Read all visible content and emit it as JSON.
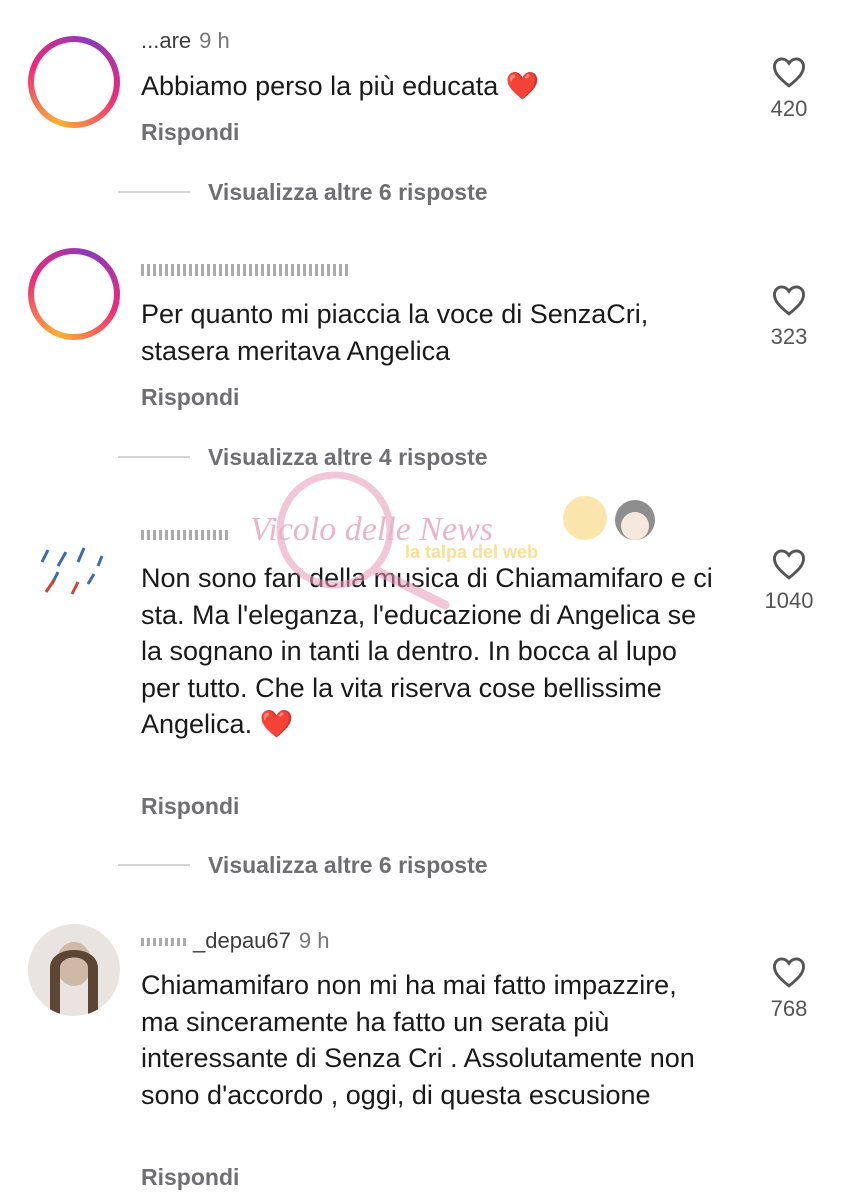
{
  "comments": [
    {
      "username": "...are",
      "time": "9 h",
      "text": "Abbiamo perso la più educata",
      "emoji": "❤️",
      "reply_label": "Rispondi",
      "likes": "420",
      "more_replies": "Visualizza altre 6 risposte"
    },
    {
      "username": "",
      "time": "",
      "text": "Per quanto mi piaccia la voce di SenzaCri, stasera meritava Angelica",
      "emoji": "",
      "reply_label": "Rispondi",
      "likes": "323",
      "more_replies": "Visualizza altre 4 risposte"
    },
    {
      "username": "",
      "time": "",
      "text": "Non sono fan della musica di Chiamamifaro e ci sta. Ma l'eleganza, l'educazione di Angelica se la sognano in tanti la dentro. In bocca al lupo per tutto. Che la vita riserva cose bellissime Angelica.",
      "emoji": "❤️",
      "reply_label": "Rispondi",
      "likes": "1040",
      "more_replies": "Visualizza altre 6 risposte"
    },
    {
      "username": "_depau67",
      "time": "9 h",
      "text": "Chiamamifaro non mi ha mai fatto impazzire,  ma sinceramente ha fatto un serata più interessante di Senza Cri . Assolutamente non sono d'accordo , oggi, di questa escusione",
      "emoji": "",
      "reply_label": "Rispondi",
      "likes": "768",
      "more_replies": ""
    }
  ],
  "watermark": {
    "logo_text": "Vicolo delle News",
    "tagline": "la talpa del web"
  },
  "colors": {
    "heart_emoji": "#e0202a",
    "story_ring": "#ee2a7b",
    "secondary_text": "#6f6f73"
  },
  "icons": [
    "heart-outline-icon",
    "avatar-icon"
  ]
}
